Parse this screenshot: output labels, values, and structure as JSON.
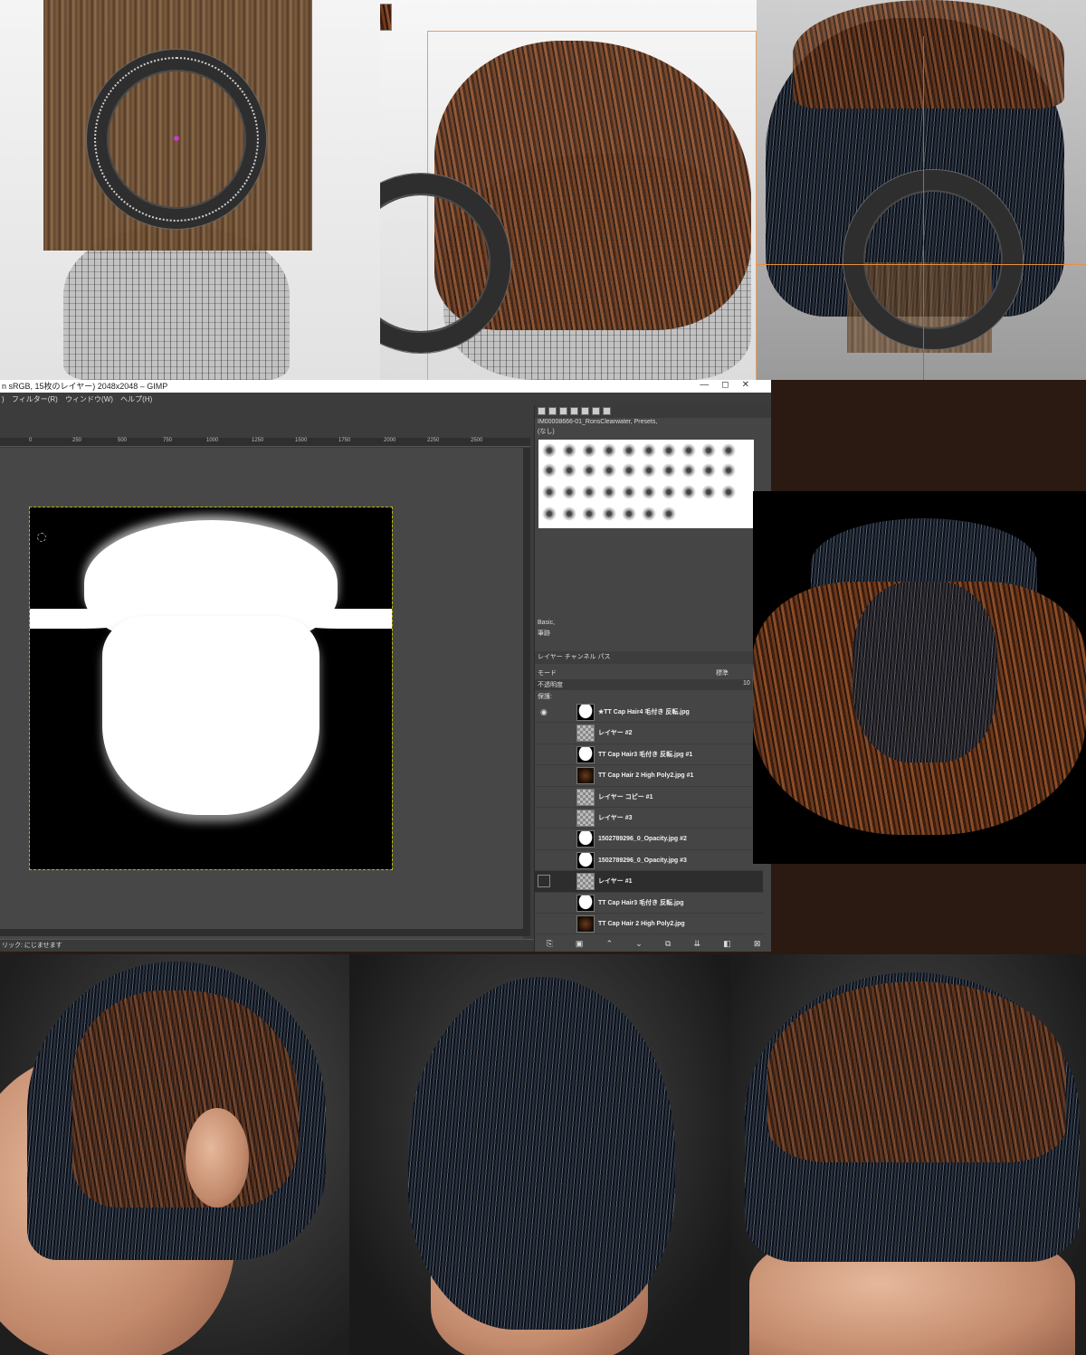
{
  "gimp": {
    "title": "n sRGB, 15枚のレイヤー) 2048x2048 – GIMP",
    "menu": ")  フィルター(R)  ウィンドウ(W)  ヘルプ(H)",
    "ruler_ticks": [
      "0",
      "250",
      "500",
      "750",
      "1000",
      "1250",
      "1500",
      "1750",
      "2000",
      "2250",
      "2500"
    ],
    "status": "リック: にじませます",
    "brush_preset": "IM00008666-01_RonsClearwater, Presets,",
    "brush_sub": "(なし)",
    "brush_name": "Basic,",
    "brush_tag": "筆跡",
    "layers_tabs": "レイヤー   チャンネル   パス",
    "mode_label": "モード",
    "mode_value": "標準",
    "opacity_label": "不透明度",
    "opacity_value": "10",
    "lock_label": "保護:",
    "layers": [
      {
        "name": "★TT Cap Hair4 毛付き 反転.jpg",
        "thumb": "white",
        "visible": true
      },
      {
        "name": "レイヤー  #2",
        "thumb": "checker",
        "visible": false
      },
      {
        "name": "TT Cap Hair3 毛付き 反転.jpg #1",
        "thumb": "white",
        "visible": false
      },
      {
        "name": "TT Cap Hair 2 High Poly2.jpg #1",
        "thumb": "dark",
        "visible": false
      },
      {
        "name": "レイヤー  コピー  #1",
        "thumb": "checker",
        "visible": false
      },
      {
        "name": "レイヤー  #3",
        "thumb": "checker",
        "visible": false
      },
      {
        "name": "1502789296_0_Opacity.jpg #2",
        "thumb": "white",
        "visible": false
      },
      {
        "name": "1502789296_0_Opacity.jpg #3",
        "thumb": "white",
        "visible": false
      },
      {
        "name": "レイヤー  #1",
        "thumb": "checker",
        "visible": false,
        "active": true
      },
      {
        "name": "TT Cap Hair3 毛付き 反転.jpg",
        "thumb": "white",
        "visible": false
      },
      {
        "name": "TT Cap Hair 2 High Poly2.jpg",
        "thumb": "dark",
        "visible": false
      }
    ]
  },
  "colors": {
    "gimp_bg": "#3c3c3c",
    "canvas_border": "#b8b800",
    "hair_brown": "#6e3a1c",
    "hair_dark": "#1a202a"
  }
}
